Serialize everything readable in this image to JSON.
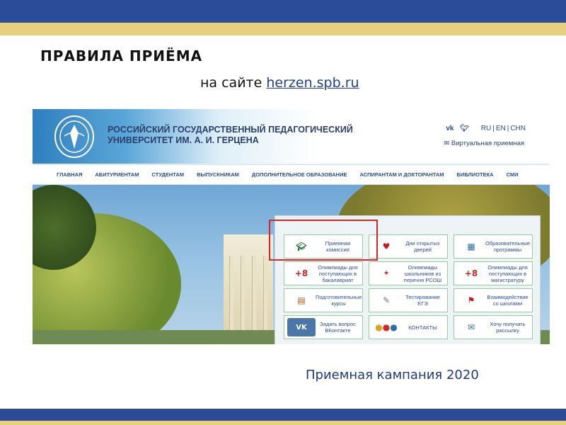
{
  "slide": {
    "title": "ПРАВИЛА ПРИЁМА",
    "subtitle_prefix": "на сайте",
    "subtitle_link": "herzen.spb.ru",
    "footer": "Приемная кампания 2020"
  },
  "colors": {
    "band_blue": "#2b4c96",
    "band_gold": "#e7cf7d",
    "highlight": "#d0282b"
  },
  "website": {
    "header": {
      "line1": "РОССИЙСКИЙ ГОСУДАРСТВЕННЫЙ ПЕДАГОГИЧЕСКИЙ",
      "line2": "УНИВЕРСИТЕТ ИМ. А. И. ГЕРЦЕНА",
      "social": [
        "vk-icon",
        "twitter-icon"
      ],
      "languages": [
        "RU",
        "EN",
        "CHN"
      ],
      "virtual_reception": "Виртуальная приемная"
    },
    "nav": [
      "ГЛАВНАЯ",
      "АБИТУРИЕНТАМ",
      "СТУДЕНТАМ",
      "ВЫПУСКНИКАМ",
      "ДОПОЛНИТЕЛЬНОЕ ОБРАЗОВАНИЕ",
      "АСПИРАНТАМ И ДОКТОРАНТАМ",
      "БИБЛИОТЕКА",
      "СМИ"
    ],
    "tiles": [
      {
        "label": "Приемная комиссия",
        "icon": "graduation-cap-icon"
      },
      {
        "label": "Дни открытых дверей",
        "icon": "heart-university-icon"
      },
      {
        "label": "Образовательные программы",
        "icon": "programs-icon"
      },
      {
        "label": "Олимпиады для поступающих в бакалавриат",
        "icon": "plus-8-icon",
        "icon_text": "+8"
      },
      {
        "label": "Олимпиады школьников из перечня РСОШ",
        "icon": "ege-icon"
      },
      {
        "label": "Олимпиады для поступающих в магистратуру",
        "icon": "plus-8-icon",
        "icon_text": "+8"
      },
      {
        "label": "Подготовительные курсы",
        "icon": "books-icon"
      },
      {
        "label": "Тестирование ЕГЭ",
        "icon": "testing-icon"
      },
      {
        "label": "Взаимодействие со школами",
        "icon": "schools-icon"
      },
      {
        "label": "Задать вопрос ВКонтакте",
        "icon": "vk-logo-icon",
        "icon_text": "VK"
      },
      {
        "label": "КОНТАКТЫ",
        "icon": "contacts-icon"
      },
      {
        "label": "Хочу получать рассылку",
        "icon": "mail-icon"
      }
    ]
  }
}
